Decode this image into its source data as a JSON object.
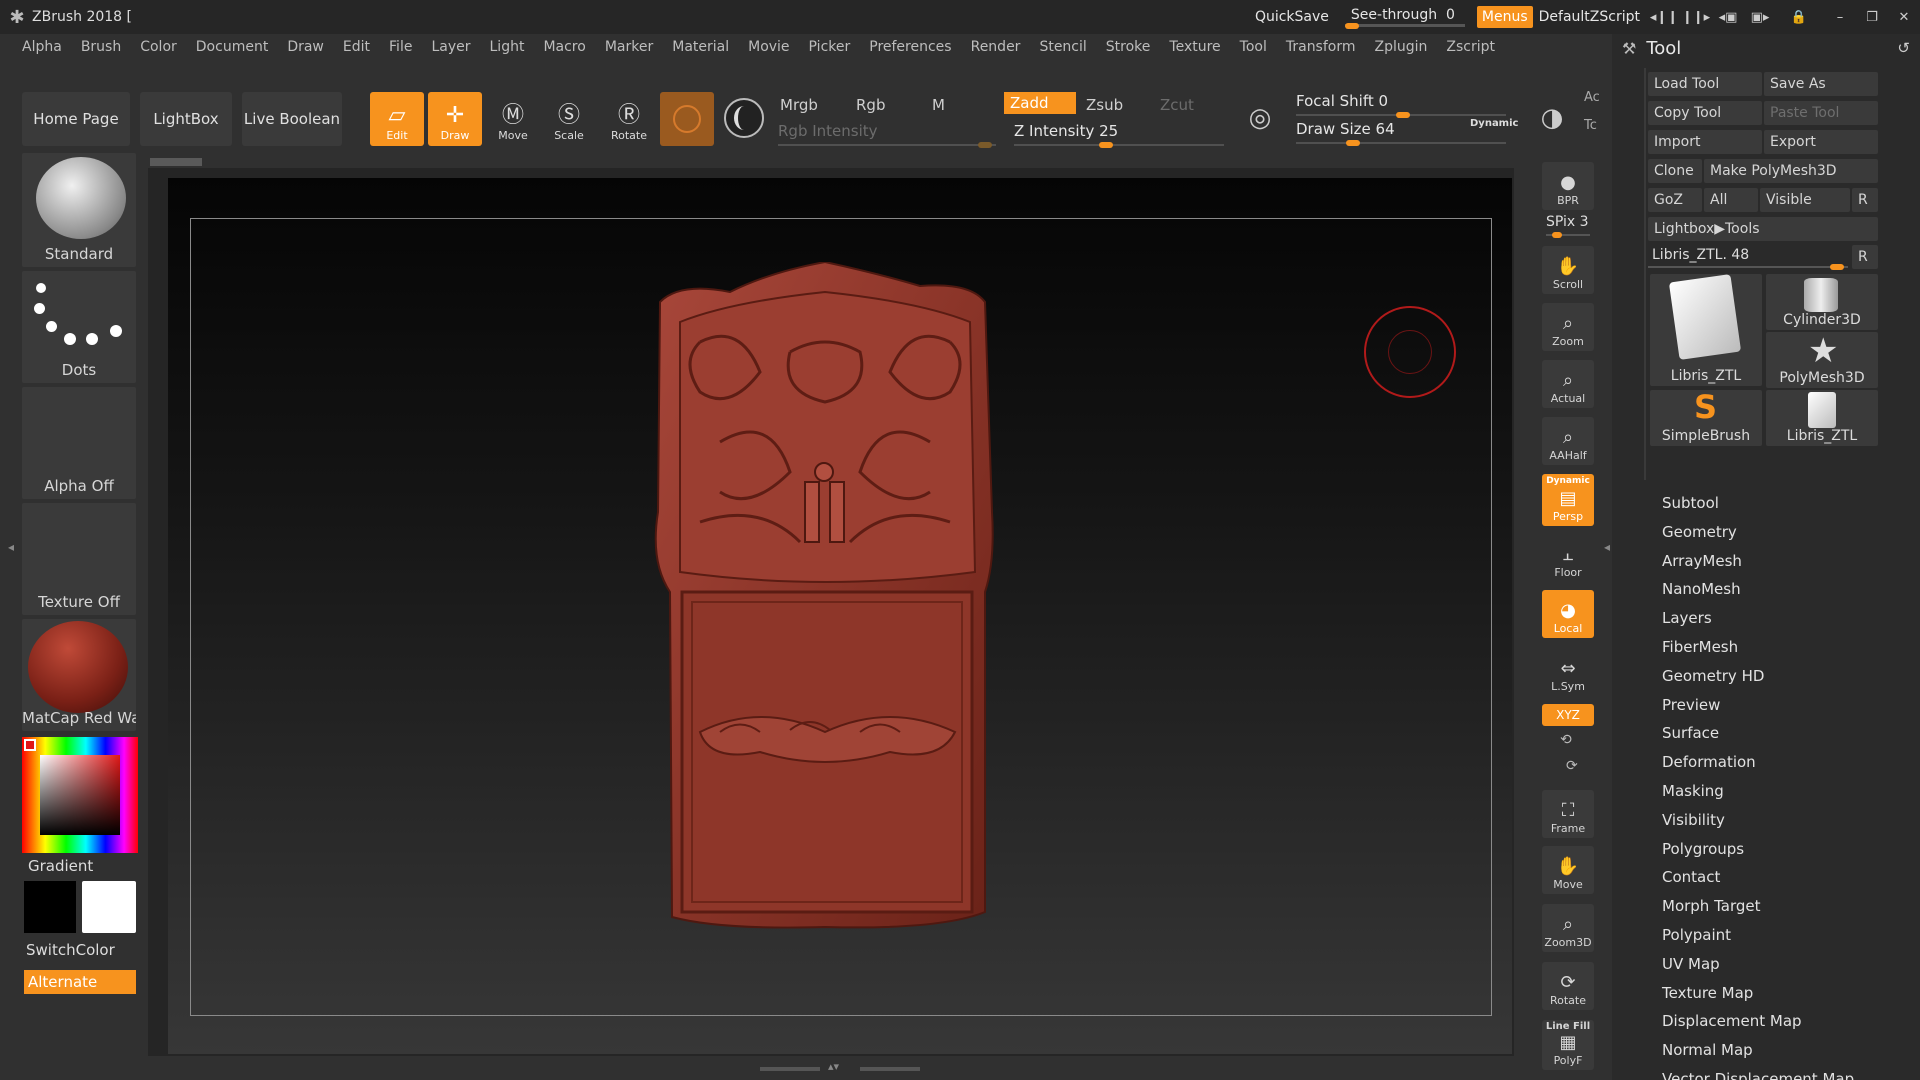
{
  "title_bar": {
    "app_title": "ZBrush 2018 [",
    "quicksave": "QuickSave",
    "see_through_label": "See-through",
    "see_through_value": "0",
    "menus_label": "Menus",
    "script_name": "DefaultZScript"
  },
  "menubar": {
    "items": [
      "Alpha",
      "Brush",
      "Color",
      "Document",
      "Draw",
      "Edit",
      "File",
      "Layer",
      "Light",
      "Macro",
      "Marker",
      "Material",
      "Movie",
      "Picker",
      "Preferences",
      "Render",
      "Stencil",
      "Stroke",
      "Texture",
      "Tool",
      "Transform",
      "Zplugin",
      "Zscript"
    ]
  },
  "toolbar": {
    "home_page": "Home Page",
    "lightbox": "LightBox",
    "live_boolean": "Live Boolean",
    "edit": "Edit",
    "draw": "Draw",
    "move": "Move",
    "scale": "Scale",
    "rotate": "Rotate",
    "mrgb": "Mrgb",
    "rgb": "Rgb",
    "m": "M",
    "zadd": "Zadd",
    "zsub": "Zsub",
    "zcut": "Zcut",
    "rgb_intensity": "Rgb Intensity",
    "z_intensity_label": "Z Intensity",
    "z_intensity_value": "25",
    "z_intensity_fraction": 0.25,
    "focal_shift_label": "Focal Shift",
    "focal_shift_value": "0",
    "draw_size_label": "Draw Size",
    "draw_size_value": "64",
    "dynamic": "Dynamic",
    "ac": "Ac",
    "tc": "Tc"
  },
  "left_panel": {
    "brush": "Standard",
    "stroke": "Dots",
    "alpha": "Alpha Off",
    "texture": "Texture Off",
    "material": "MatCap Red Wax",
    "gradient": "Gradient",
    "switch_color": "SwitchColor",
    "alternate": "Alternate",
    "colors": {
      "main": "#000000",
      "secondary": "#ffffff",
      "accent": "#f7931e",
      "material": "#8c2a1e"
    }
  },
  "right_shelf": {
    "bpr": "BPR",
    "spix_label": "SPix",
    "spix_value": "3",
    "scroll": "Scroll",
    "zoom": "Zoom",
    "actual": "Actual",
    "aahalf": "AAHalf",
    "dynamic": "Dynamic",
    "persp": "Persp",
    "floor": "Floor",
    "local": "Local",
    "lsym": "L.Sym",
    "xyz": "XYZ",
    "frame": "Frame",
    "move": "Move",
    "zoom3d": "Zoom3D",
    "rotate": "Rotate",
    "line_fill": "Line Fill",
    "polyf": "PolyF"
  },
  "tool_panel": {
    "title": "Tool",
    "load_tool": "Load Tool",
    "save_as": "Save As",
    "copy_tool": "Copy Tool",
    "paste_tool": "Paste Tool",
    "import": "Import",
    "export": "Export",
    "clone": "Clone",
    "make_polymesh": "Make PolyMesh3D",
    "goz": "GoZ",
    "all": "All",
    "visible": "Visible",
    "r": "R",
    "lightbox_tools": "Lightbox▶Tools",
    "current_tool_label": "Libris_ZTL.",
    "current_tool_value": "48",
    "thumbs": [
      "Libris_ZTL",
      "Cylinder3D",
      "PolyMesh3D",
      "SimpleBrush",
      "Libris_ZTL"
    ],
    "subpalettes": [
      "Subtool",
      "Geometry",
      "ArrayMesh",
      "NanoMesh",
      "Layers",
      "FiberMesh",
      "Geometry HD",
      "Preview",
      "Surface",
      "Deformation",
      "Masking",
      "Visibility",
      "Polygroups",
      "Contact",
      "Morph Target",
      "Polypaint",
      "UV Map",
      "Texture Map",
      "Displacement Map",
      "Normal Map",
      "Vector Displacement Map"
    ]
  }
}
